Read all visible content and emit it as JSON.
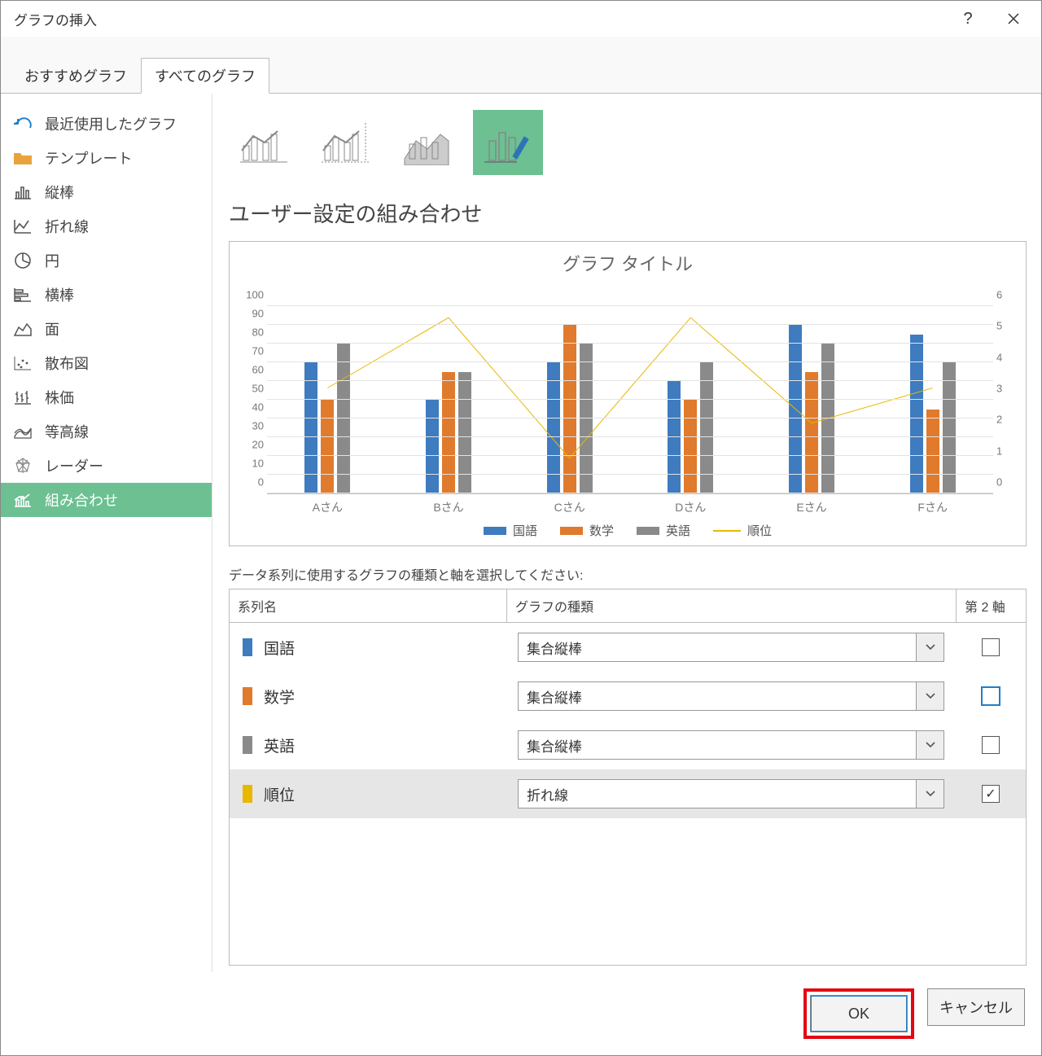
{
  "window": {
    "title": "グラフの挿入"
  },
  "tabs": [
    {
      "label": "おすすめグラフ",
      "active": false
    },
    {
      "label": "すべてのグラフ",
      "active": true
    }
  ],
  "sidebar": {
    "items": [
      {
        "label": "最近使用したグラフ"
      },
      {
        "label": "テンプレート"
      },
      {
        "label": "縦棒"
      },
      {
        "label": "折れ線"
      },
      {
        "label": "円"
      },
      {
        "label": "横棒"
      },
      {
        "label": "面"
      },
      {
        "label": "散布図"
      },
      {
        "label": "株価"
      },
      {
        "label": "等高線"
      },
      {
        "label": "レーダー"
      },
      {
        "label": "組み合わせ"
      }
    ],
    "selected": 11
  },
  "heading": "ユーザー設定の組み合わせ",
  "preview": {
    "title": "グラフ タイトル"
  },
  "chart_data": {
    "type": "combo",
    "categories": [
      "Aさん",
      "Bさん",
      "Cさん",
      "Dさん",
      "Eさん",
      "Fさん"
    ],
    "series": [
      {
        "name": "国語",
        "type": "bar",
        "axis": "primary",
        "color": "#3f7bbf",
        "values": [
          70,
          50,
          70,
          60,
          90,
          85
        ]
      },
      {
        "name": "数学",
        "type": "bar",
        "axis": "primary",
        "color": "#e07a2c",
        "values": [
          50,
          65,
          90,
          50,
          65,
          45
        ]
      },
      {
        "name": "英語",
        "type": "bar",
        "axis": "primary",
        "color": "#8a8a8a",
        "values": [
          80,
          65,
          80,
          70,
          80,
          70
        ]
      },
      {
        "name": "順位",
        "type": "line",
        "axis": "secondary",
        "color": "#e8b800",
        "values": [
          3,
          5,
          1,
          5,
          2,
          3
        ]
      }
    ],
    "y_primary": {
      "min": 0,
      "max": 100,
      "step": 10
    },
    "y_secondary": {
      "min": 0,
      "max": 6,
      "step": 1
    },
    "legend": [
      "国語",
      "数学",
      "英語",
      "順位"
    ]
  },
  "series_table": {
    "instruction": "データ系列に使用するグラフの種類と軸を選択してください:",
    "headers": {
      "name": "系列名",
      "type": "グラフの種類",
      "axis2": "第 2 軸"
    },
    "rows": [
      {
        "name": "国語",
        "color": "#3f7bbf",
        "chart_type": "集合縦棒",
        "axis2": false
      },
      {
        "name": "数学",
        "color": "#e07a2c",
        "chart_type": "集合縦棒",
        "axis2": false,
        "axis2_focus": true
      },
      {
        "name": "英語",
        "color": "#8a8a8a",
        "chart_type": "集合縦棒",
        "axis2": false
      },
      {
        "name": "順位",
        "color": "#e8b800",
        "chart_type": "折れ線",
        "axis2": true,
        "selected": true
      }
    ]
  },
  "buttons": {
    "ok": "OK",
    "cancel": "キャンセル"
  }
}
